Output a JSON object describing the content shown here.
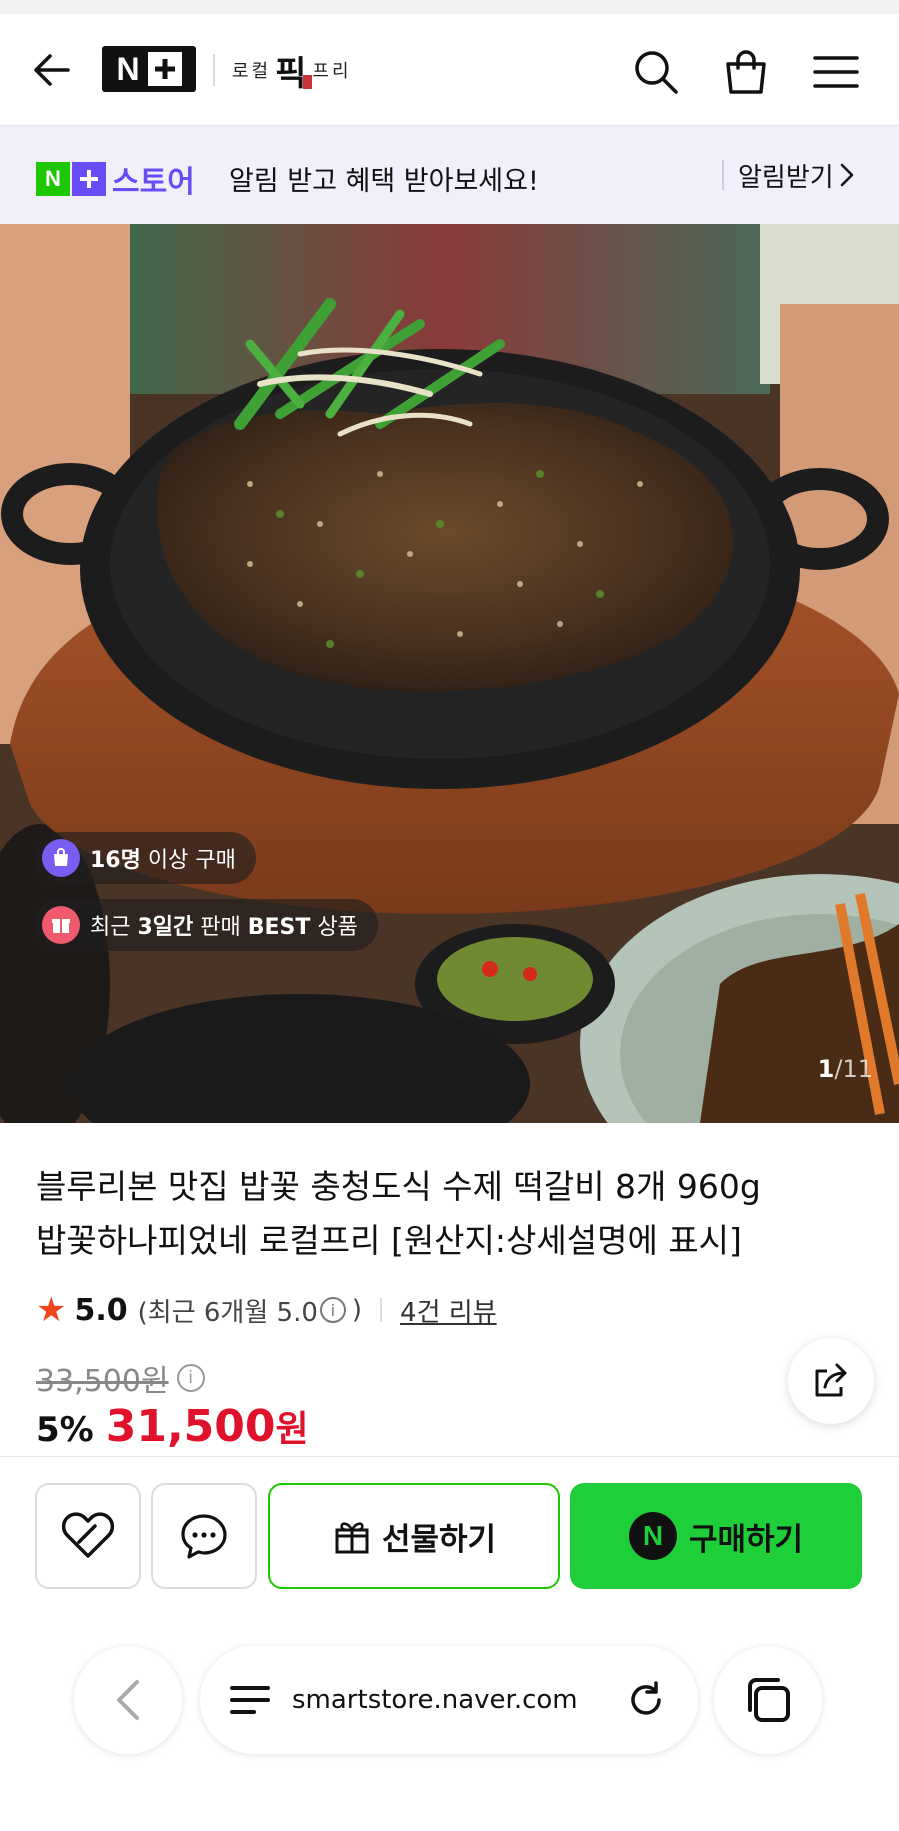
{
  "header": {
    "store_logo": "N+",
    "brand_name_left": "로컬",
    "brand_name_mid": "픽",
    "brand_name_right": "프리"
  },
  "notification": {
    "store_label": "스토어",
    "message": "알림 받고 혜택 받아보세요!",
    "action_label": "알림받기"
  },
  "hero": {
    "badges": [
      {
        "strong": "16명",
        "text": " 이상 구매"
      },
      {
        "text_pre": "최근 ",
        "strong": "3일간",
        "text_mid": " 판매 ",
        "strong2": "BEST",
        "text_post": " 상품"
      }
    ],
    "counter_current": "1",
    "counter_sep": "/",
    "counter_total": "11"
  },
  "product": {
    "title_line1": "블루리본 맛집 밥꽃 충청도식 수제 떡갈비 8개 960g",
    "title_line2": "밥꽃하나피었네 로컬프리 [원산지:상세설명에 표시]",
    "rating": "5.0",
    "recent_rating_prefix": "(최근 6개월 5.0",
    "recent_rating_suffix": ")",
    "reviews_label": "4건 리뷰",
    "original_price": "33,500원",
    "discount_percent": "5%",
    "sale_price": "31,500",
    "currency": "원"
  },
  "actions": {
    "gift_label": "선물하기",
    "buy_label": "구매하기",
    "buy_badge": "N"
  },
  "browser": {
    "url": "smartstore.naver.com"
  },
  "colors": {
    "naver_green": "#1ec800",
    "store_purple": "#6a4cf6",
    "sale_red": "#e0112b",
    "rating_star": "#f0461e"
  }
}
